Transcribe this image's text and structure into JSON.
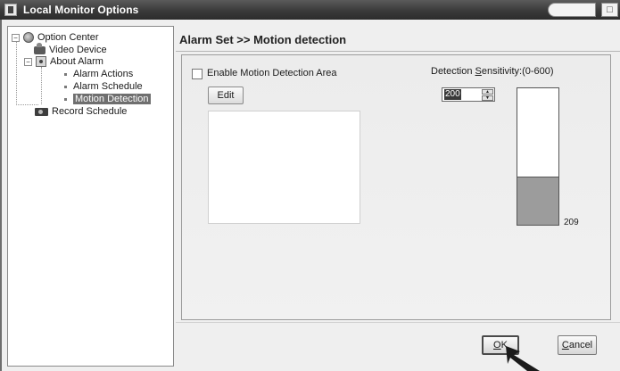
{
  "window": {
    "title": "Local Monitor Options",
    "maximize_glyph": "□"
  },
  "tree": {
    "items": [
      {
        "label": "Option Center",
        "icon": "globe-icon",
        "expander": "−"
      },
      {
        "label": "Video Device",
        "icon": "camera-icon"
      },
      {
        "label": "About Alarm",
        "icon": "alarm-icon",
        "expander": "−"
      },
      {
        "label": "Alarm Actions"
      },
      {
        "label": "Alarm Schedule"
      },
      {
        "label": "Motion Detection",
        "selected": true
      },
      {
        "label": "Record Schedule",
        "icon": "record-icon"
      }
    ]
  },
  "header": {
    "breadcrumb": "Alarm Set >> Motion detection"
  },
  "motion": {
    "enable_label": "Enable Motion Detection Area",
    "enabled": false,
    "edit_label": "Edit"
  },
  "sensitivity": {
    "label_prefix": "Detection ",
    "label_accel": "S",
    "label_rest": "ensitivity:(0-600)",
    "value": "200",
    "range": [
      0,
      600
    ],
    "level_value": "209",
    "level_fraction": 0.35
  },
  "buttons": {
    "ok_accel": "O",
    "ok_rest": "K",
    "cancel_accel": "C",
    "cancel_rest": "ancel"
  },
  "colors": {
    "selected_bg": "#6f6f6f",
    "level_fill": "#9c9c9c"
  }
}
